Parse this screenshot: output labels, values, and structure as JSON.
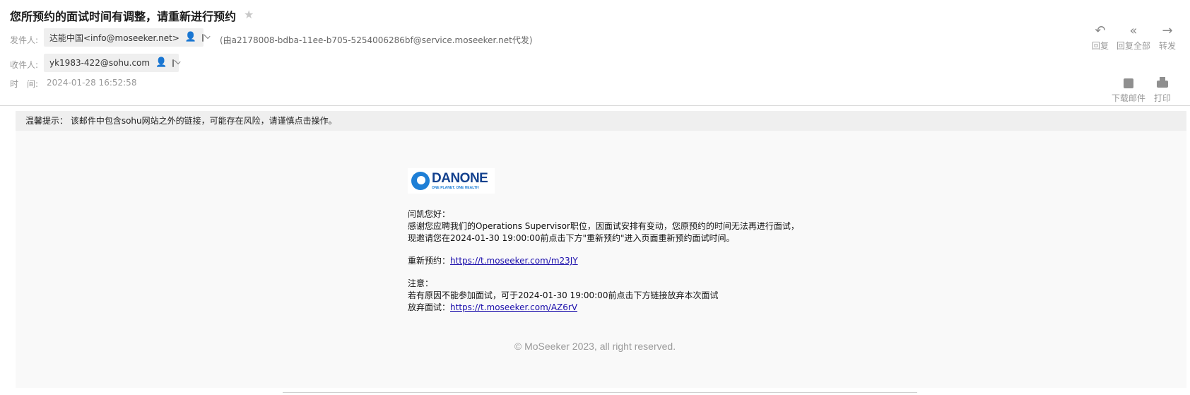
{
  "header": {
    "subject": "您所预约的面试时间有调整，请重新进行预约",
    "from_label": "发件人:",
    "from_name": "达能中国<info@moseeker.net>",
    "via": "(由a2178008-bdba-11ee-b705-5254006286bf@service.moseeker.net代发)",
    "to_label": "收件人:",
    "to_address": "yk1983-422@sohu.com",
    "time_label": "时　间:",
    "time_value": "2024-01-28 16:52:58"
  },
  "toolbar": {
    "reply": "回复",
    "reply_all": "回复全部",
    "forward": "转发",
    "download": "下载邮件",
    "print": "打印"
  },
  "warning": {
    "text": "温馨提示： 该邮件中包含sohu网站之外的链接，可能存在风险，请谨慎点击操作。"
  },
  "logo": {
    "word": "DANONE",
    "tagline": "ONE PLANET. ONE HEALTH"
  },
  "body": {
    "greeting": "闫凯您好：",
    "line1": "感谢您应聘我们的Operations Supervisor职位，因面试安排有变动，您原预约的时间无法再进行面试，",
    "line2": "现邀请您在2024-01-30 19:00:00前点击下方\"重新预约\"进入页面重新预约面试时间。",
    "rebook_label": "重新预约：",
    "rebook_link": "https://t.moseeker.com/m23JY",
    "note_label": "注意：",
    "note_line": "若有原因不能参加面试，可于2024-01-30 19:00:00前点击下方链接放弃本次面试",
    "giveup_label": "放弃面试：",
    "giveup_link": "https://t.moseeker.com/AZ6rV",
    "footer": "© MoSeeker 2023, all right reserved."
  },
  "colors": {
    "accent_logo": "#13418e",
    "link": "#1a0dab"
  }
}
